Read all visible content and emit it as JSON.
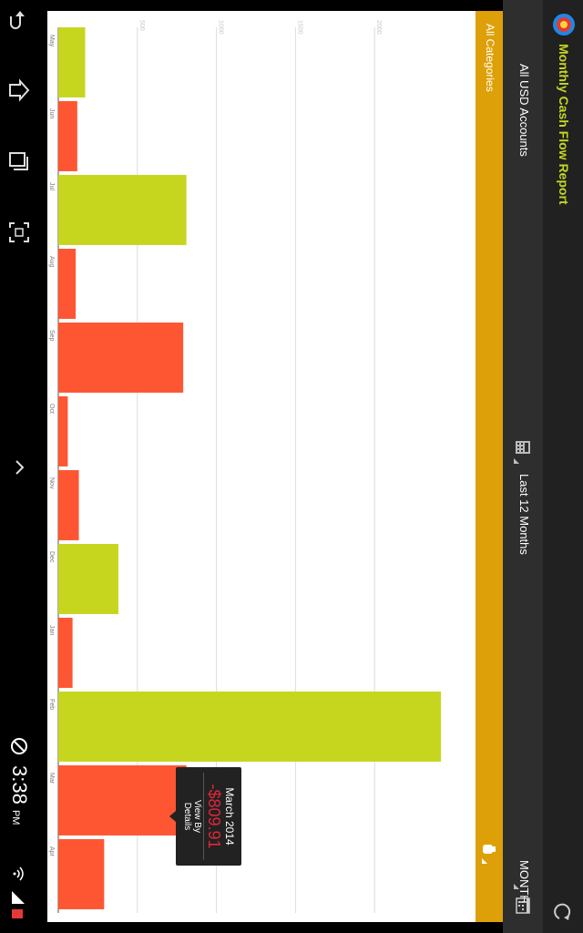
{
  "app": {
    "title": "Monthly Cash Flow Report",
    "icon": "app-logo-icon",
    "refresh_icon": "refresh-icon"
  },
  "filters": {
    "accounts": "All USD Accounts",
    "period": "Last 12 Months",
    "interval": "MONTH",
    "categories": "All Categories"
  },
  "tooltip": {
    "month": "March 2014",
    "value": "-$809.91",
    "link_line1": "View By",
    "link_line2": "Details"
  },
  "system": {
    "time": "3:38",
    "ampm": "PM"
  },
  "colors": {
    "income": "#c6d61f",
    "expense": "#fe5632",
    "accent": "#dea008",
    "tooltip_value": "#e5233a"
  },
  "chart_data": {
    "type": "bar",
    "categories": [
      "May",
      "Jun",
      "Jul",
      "Aug",
      "Sep",
      "Oct",
      "Nov",
      "Dec",
      "Jan",
      "Feb",
      "Mar",
      "Apr"
    ],
    "values": [
      170,
      120,
      810,
      110,
      790,
      60,
      130,
      380,
      90,
      2420,
      809.91,
      290
    ],
    "kind": [
      "income",
      "expense",
      "income",
      "expense",
      "expense",
      "expense",
      "expense",
      "income",
      "expense",
      "income",
      "expense",
      "expense"
    ],
    "y_ticks": [
      "500",
      "1000",
      "1500",
      "2000"
    ],
    "y_tick_values": [
      500,
      1000,
      1500,
      2000
    ],
    "ylim": [
      0,
      2500
    ],
    "grid": true
  }
}
